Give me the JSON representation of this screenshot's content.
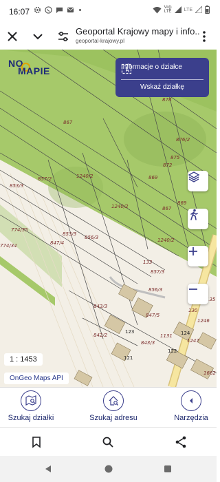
{
  "status_bar": {
    "time": "16:07",
    "network_top": "Vo))",
    "network_bottom": "LTE",
    "network_secondary": "LTE"
  },
  "app_bar": {
    "title": "Geoportal Krajowy mapy i info...",
    "url": "geoportal-krajowy.pl"
  },
  "map": {
    "logo_top": "NO",
    "logo_bottom": "MAPIE",
    "info_button": "Informacje o działce",
    "show_parcel_button": "Wskaż działkę",
    "scale": "1 : 1453",
    "attribution": "OnGeo Maps API",
    "parcel_labels": [
      "878",
      "867",
      "876/2",
      "875",
      "872",
      "857/2",
      "1240/2",
      "869",
      "853/3",
      "1240/2",
      "867",
      "869",
      "774/35",
      "853/3",
      "856/3",
      "847/4",
      "1240/2",
      "774/34",
      "133",
      "857/3",
      "856/3",
      "843/3",
      "847/5",
      "842/2",
      "843/3",
      "1131",
      "135",
      "130",
      "1246",
      "1247",
      "1662"
    ],
    "building_labels": [
      "123",
      "121",
      "124",
      "122"
    ],
    "colors": {
      "forest": "#a6c96a",
      "grassland": "#c9d8a8",
      "built": "#f3efe6",
      "road": "#f6e6a0",
      "accent": "#3b3f8c"
    }
  },
  "toolbar": {
    "search_parcel": "Szukaj działki",
    "search_address": "Szukaj adresu",
    "tools": "Narzędzia"
  },
  "icons": {
    "close": "close-icon",
    "chevron": "chevron-down-icon",
    "settings": "tune-icon",
    "more": "more-vert-icon",
    "bookmark": "bookmark-icon",
    "search": "search-icon",
    "share": "share-icon"
  }
}
